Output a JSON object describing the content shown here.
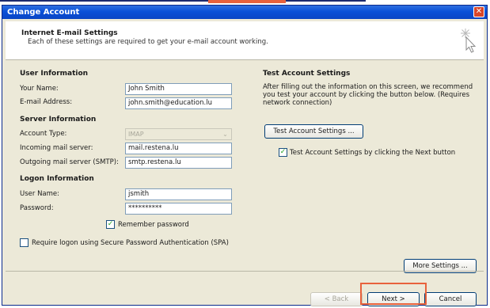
{
  "window": {
    "title": "Change Account",
    "close_glyph": "✕"
  },
  "header": {
    "title": "Internet E-mail Settings",
    "subtitle": "Each of these settings are required to get your e-mail account working."
  },
  "user_info": {
    "section": "User Information",
    "name_label": "Your Name:",
    "name_value": "John Smith",
    "email_label": "E-mail Address:",
    "email_value": "john.smith@education.lu"
  },
  "server_info": {
    "section": "Server Information",
    "account_type_label": "Account Type:",
    "account_type_value": "IMAP",
    "incoming_label": "Incoming mail server:",
    "incoming_value": "mail.restena.lu",
    "outgoing_label": "Outgoing mail server (SMTP):",
    "outgoing_value": "smtp.restena.lu"
  },
  "logon_info": {
    "section": "Logon Information",
    "username_label": "User Name:",
    "username_value": "jsmith",
    "password_label": "Password:",
    "password_value": "**********",
    "remember_label": "Remember password",
    "remember_checked": true,
    "spa_label": "Require logon using Secure Password Authentication (SPA)",
    "spa_checked": false
  },
  "test_settings": {
    "section": "Test Account Settings",
    "description": "After filling out the information on this screen, we recommend you test your account by clicking the button below. (Requires network connection)",
    "test_button": "Test Account Settings ...",
    "next_test_label": "Test Account Settings by clicking the Next button",
    "next_test_checked": true
  },
  "buttons": {
    "more_settings": "More Settings ...",
    "back": "< Back",
    "next": "Next >",
    "cancel": "Cancel"
  },
  "colors": {
    "titlebar": "#0a50d8",
    "highlight": "#e8623c",
    "check": "#21a121"
  },
  "icons": {
    "wizard": "wizard-sparkle-cursor-icon"
  }
}
